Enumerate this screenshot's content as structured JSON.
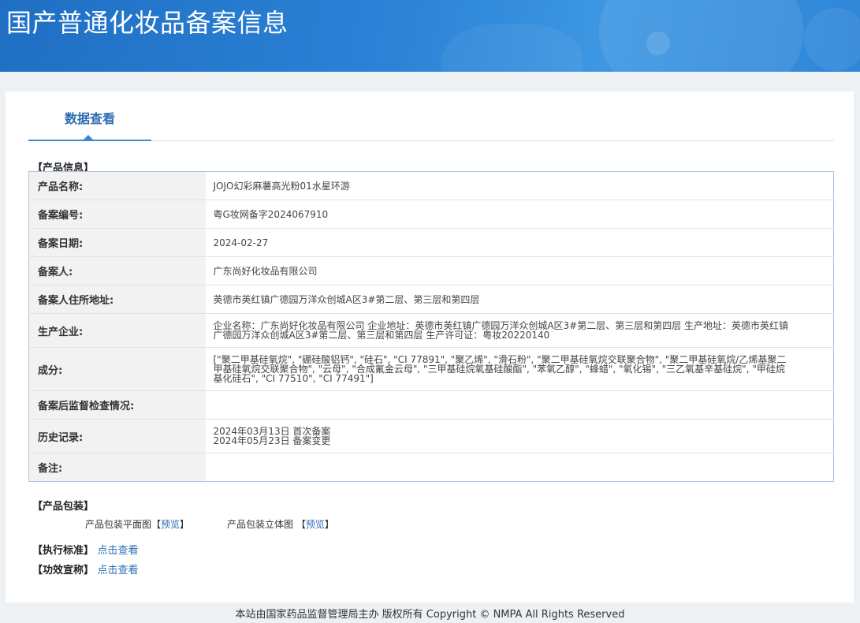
{
  "header": {
    "title": "国产普通化妆品备案信息"
  },
  "tabs": {
    "active_label": "数据查看"
  },
  "product_info": {
    "section_title": "【产品信息】",
    "rows": [
      {
        "label": "产品名称:",
        "value": "JOJO幻彩麻薯高光粉01水星环游"
      },
      {
        "label": "备案编号:",
        "value": "粤G妆网备字2024067910"
      },
      {
        "label": "备案日期:",
        "value": "2024-02-27"
      },
      {
        "label": "备案人:",
        "value": "广东尚好化妆品有限公司"
      },
      {
        "label": "备案人住所地址:",
        "value": "英德市英红镇广德园万洋众创城A区3#第二层、第三层和第四层"
      },
      {
        "label": "生产企业:",
        "value": "企业名称：广东尚好化妆品有限公司 企业地址：英德市英红镇广德园万洋众创城A区3#第二层、第三层和第四层 生产地址：英德市英红镇广德园万洋众创城A区3#第二层、第三层和第四层 生产许可证：粤妆20220140"
      },
      {
        "label": "成分:",
        "value": "[\"聚二甲基硅氧烷\", \"硼硅酸铝钙\", \"硅石\", \"CI 77891\", \"聚乙烯\", \"滑石粉\", \"聚二甲基硅氧烷交联聚合物\", \"聚二甲基硅氧烷/乙烯基聚二甲基硅氧烷交联聚合物\", \"云母\", \"合成氟金云母\", \"三甲基硅烷氧基硅酸酯\", \"苯氧乙醇\", \"蜂蜡\", \"氧化锡\", \"三乙氧基辛基硅烷\", \"甲硅烷基化硅石\", \"CI 77510\", \"CI 77491\"]"
      },
      {
        "label": "备案后监督检查情况:",
        "value": ""
      },
      {
        "label": "历史记录:",
        "value": "",
        "history": [
          "2024年03月13日 首次备案",
          "2024年05月23日 备案变更"
        ]
      },
      {
        "label": "备注:",
        "value": ""
      }
    ]
  },
  "packaging": {
    "section_title": "【产品包装】",
    "flat_label": "产品包装平面图",
    "stereo_label": "产品包装立体图",
    "preview_text": "预览",
    "bracket_open": "【",
    "bracket_close": "】"
  },
  "standard": {
    "section_title": "【执行标准】",
    "link_text": "点击查看"
  },
  "efficacy": {
    "section_title": "【功效宣称】",
    "link_text": "点击查看"
  },
  "footer": {
    "text": "本站由国家药品监督管理局主办 版权所有 Copyright © NMPA All Rights Reserved"
  }
}
